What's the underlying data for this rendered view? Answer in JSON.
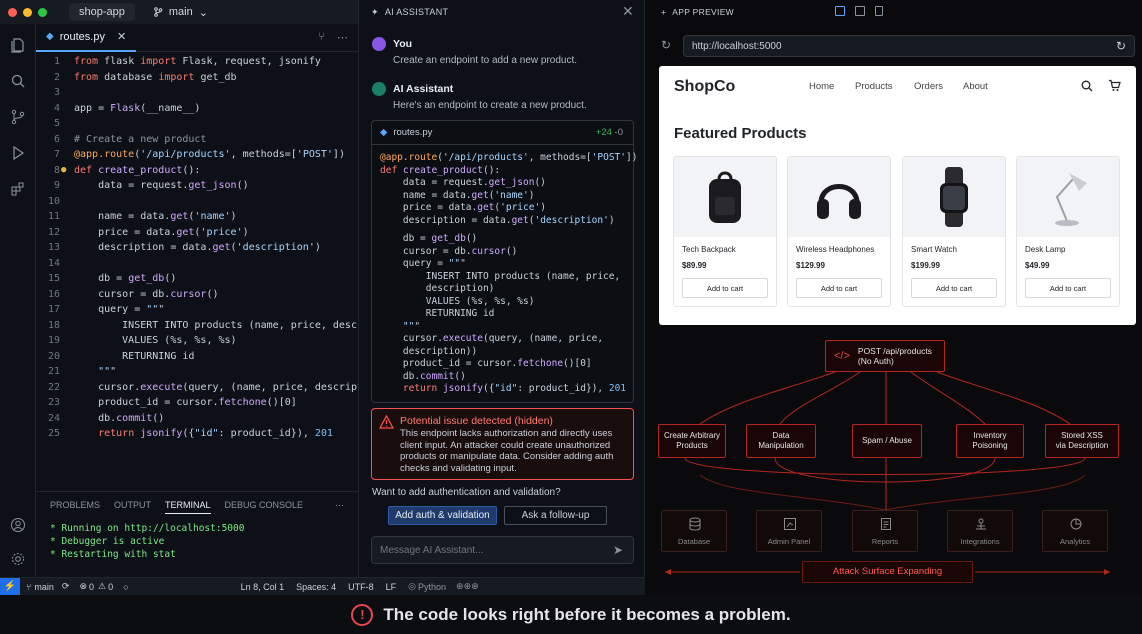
{
  "titlebar": {
    "app": "shop-app",
    "branch": "main"
  },
  "editor": {
    "tab": "routes.py",
    "lines": [
      {
        "n": "1",
        "t": "from flask import Flask, request, jsonify"
      },
      {
        "n": "2",
        "t": "from database import get_db"
      },
      {
        "n": "3",
        "t": ""
      },
      {
        "n": "4",
        "t": "app = Flask(__name__)"
      },
      {
        "n": "5",
        "t": ""
      },
      {
        "n": "6",
        "t": "# Create a new product"
      },
      {
        "n": "7",
        "t": "@app.route('/api/products', methods=['POST'])"
      },
      {
        "n": "8",
        "t": "def create_product():"
      },
      {
        "n": "9",
        "t": "    data = request.get_json()"
      },
      {
        "n": "10",
        "t": ""
      },
      {
        "n": "11",
        "t": "    name = data.get('name')"
      },
      {
        "n": "12",
        "t": "    price = data.get('price')"
      },
      {
        "n": "13",
        "t": "    description = data.get('description')"
      },
      {
        "n": "14",
        "t": ""
      },
      {
        "n": "15",
        "t": "    db = get_db()"
      },
      {
        "n": "16",
        "t": "    cursor = db.cursor()"
      },
      {
        "n": "17",
        "t": "    query = \"\"\""
      },
      {
        "n": "18",
        "t": "        INSERT INTO products (name, price, description"
      },
      {
        "n": "19",
        "t": "        VALUES (%s, %s, %s)"
      },
      {
        "n": "20",
        "t": "        RETURNING id"
      },
      {
        "n": "21",
        "t": "    \"\"\""
      },
      {
        "n": "22",
        "t": "    cursor.execute(query, (name, price, description))"
      },
      {
        "n": "23",
        "t": "    product_id = cursor.fetchone()[0]"
      },
      {
        "n": "24",
        "t": "    db.commit()"
      },
      {
        "n": "25",
        "t": "    return jsonify({\"id\": product_id}), 201"
      }
    ]
  },
  "panel": {
    "tabs": [
      "PROBLEMS",
      "OUTPUT",
      "TERMINAL",
      "DEBUG CONSOLE"
    ],
    "terminal": [
      "* Running on http://localhost:5000",
      "* Debugger is active",
      "* Restarting with stat"
    ]
  },
  "statusbar": {
    "branch": "main",
    "problems": "0",
    "warnings": "0",
    "position": "Ln 8, Col 1",
    "spaces": "Spaces: 4",
    "encoding": "UTF-8",
    "eol": "LF",
    "lang": "Python"
  },
  "assistant": {
    "header": "AI ASSISTANT",
    "user_name": "You",
    "user_msg": "Create an endpoint to add a new product.",
    "ai_name": "AI Assistant",
    "ai_msg": "Here's an endpoint to create a new product.",
    "card_file": "routes.py",
    "card_add": "+24",
    "card_del": "-0",
    "card_lines": [
      "@app.route('/api/products', methods=['POST'])",
      "def create_product():",
      "    data = request.get_json()",
      "    name = data.get('name')",
      "    price = data.get('price')",
      "    description = data.get('description')",
      "",
      "    db = get_db()",
      "    cursor = db.cursor()",
      "    query = \"\"\"",
      "        INSERT INTO products (name, price,",
      "        description)",
      "        VALUES (%s, %s, %s)",
      "        RETURNING id",
      "    \"\"\"",
      "    cursor.execute(query, (name, price,",
      "    description))",
      "    product_id = cursor.fetchone()[0]",
      "    db.commit()",
      "    return jsonify({\"id\": product_id}), 201"
    ],
    "issue_title": "Potential issue detected (hidden)",
    "issue_body": "This endpoint lacks authorization and directly uses client input. An attacker could create unauthorized products or manipulate data. Consider adding auth checks and validating input.",
    "question": "Want to add authentication and validation?",
    "btn_primary": "Add auth & validation",
    "btn_secondary": "Ask a follow-up",
    "placeholder": "Message AI Assistant..."
  },
  "preview": {
    "header": "APP PREVIEW",
    "url": "http://localhost:5000",
    "logo": "ShopCo",
    "nav": [
      "Home",
      "Products",
      "Orders",
      "About"
    ],
    "heading": "Featured Products",
    "cart_label": "Add to cart",
    "products": [
      {
        "name": "Tech Backpack",
        "price": "$89.99"
      },
      {
        "name": "Wireless Headphones",
        "price": "$129.99"
      },
      {
        "name": "Smart Watch",
        "price": "$199.99"
      },
      {
        "name": "Desk Lamp",
        "price": "$49.99"
      }
    ]
  },
  "attack": {
    "center_line1": "POST /api/products",
    "center_line2": "(No Auth)",
    "threats": [
      {
        "l1": "Create Arbitrary",
        "l2": "Products"
      },
      {
        "l1": "Data",
        "l2": "Manipulation"
      },
      {
        "l1": "Spam / Abuse",
        "l2": ""
      },
      {
        "l1": "Inventory",
        "l2": "Poisoning"
      },
      {
        "l1": "Stored XSS",
        "l2": "via Description"
      }
    ],
    "systems": [
      "Database",
      "Admin Panel",
      "Reports",
      "Integrations",
      "Analytics"
    ],
    "expanding": "Attack Surface Expanding"
  },
  "footer": {
    "text": "The code looks right before it becomes a problem."
  },
  "colors": {
    "accent": "#1f6feb",
    "danger": "#e5484d",
    "issue": "#f85149"
  }
}
